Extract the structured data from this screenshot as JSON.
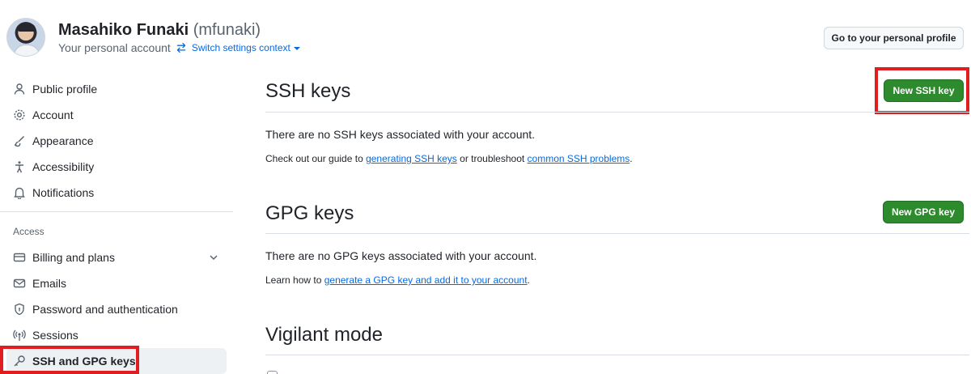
{
  "header": {
    "display_name": "Masahiko Funaki",
    "login": "(mfunaki)",
    "account_label": "Your personal account",
    "switch_context": "Switch settings context",
    "profile_button": "Go to your personal profile"
  },
  "sidebar": {
    "items": [
      {
        "label": "Public profile",
        "icon": "person-icon"
      },
      {
        "label": "Account",
        "icon": "gear-icon"
      },
      {
        "label": "Appearance",
        "icon": "paintbrush-icon"
      },
      {
        "label": "Accessibility",
        "icon": "accessibility-icon"
      },
      {
        "label": "Notifications",
        "icon": "bell-icon"
      }
    ],
    "access_label": "Access",
    "access_items": [
      {
        "label": "Billing and plans",
        "icon": "credit-card-icon"
      },
      {
        "label": "Emails",
        "icon": "mail-icon"
      },
      {
        "label": "Password and authentication",
        "icon": "shield-lock-icon"
      },
      {
        "label": "Sessions",
        "icon": "broadcast-icon"
      },
      {
        "label": "SSH and GPG keys",
        "icon": "key-icon"
      }
    ]
  },
  "ssh": {
    "title": "SSH keys",
    "button": "New SSH key",
    "empty": "There are no SSH keys associated with your account.",
    "guide_prefix": "Check out our guide to ",
    "guide_link": "generating SSH keys",
    "guide_middle": " or troubleshoot ",
    "guide_link2": "common SSH problems",
    "guide_suffix": "."
  },
  "gpg": {
    "title": "GPG keys",
    "button": "New GPG key",
    "empty": "There are no GPG keys associated with your account.",
    "learn_prefix": "Learn how to ",
    "learn_link": "generate a GPG key and add it to your account",
    "learn_suffix": "."
  },
  "vigilant": {
    "title": "Vigilant mode"
  },
  "colors": {
    "accent": "#0969da",
    "primary_button": "#2d8a2d",
    "highlight_box": "#e01e22"
  }
}
